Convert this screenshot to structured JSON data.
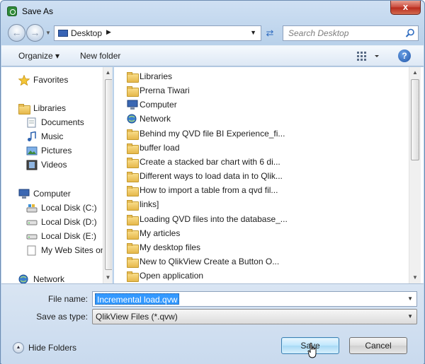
{
  "window": {
    "title": "Save As",
    "close_label": "x"
  },
  "address": {
    "location": "Desktop",
    "search_placeholder": "Search Desktop"
  },
  "toolbar": {
    "organize_label": "Organize ▾",
    "newfolder_label": "New folder"
  },
  "nav": {
    "favorites": "Favorites",
    "libraries": "Libraries",
    "library_items": [
      "Documents",
      "Music",
      "Pictures",
      "Videos"
    ],
    "computer": "Computer",
    "drives": [
      "Local Disk (C:)",
      "Local Disk (D:)",
      "Local Disk (E:)",
      "My Web Sites on"
    ],
    "network": "Network"
  },
  "files": [
    {
      "name": "Libraries",
      "icon": "library-icon"
    },
    {
      "name": "Prerna Tiwari",
      "icon": "user-folder-icon"
    },
    {
      "name": "Computer",
      "icon": "computer-icon"
    },
    {
      "name": "Network",
      "icon": "network-icon"
    },
    {
      "name": "Behind my QVD file   BI Experience_fi...",
      "icon": "folder-icon"
    },
    {
      "name": "buffer load",
      "icon": "folder-icon"
    },
    {
      "name": "Create a stacked bar chart with 6 di...",
      "icon": "folder-icon"
    },
    {
      "name": "Different ways to load data in to Qlik...",
      "icon": "folder-icon"
    },
    {
      "name": "How to import a table from a qvd fil...",
      "icon": "folder-icon"
    },
    {
      "name": "links]",
      "icon": "folder-icon"
    },
    {
      "name": "Loading QVD files into the database_...",
      "icon": "folder-icon"
    },
    {
      "name": "My articles",
      "icon": "folder-icon"
    },
    {
      "name": "My desktop files",
      "icon": "folder-icon"
    },
    {
      "name": "New to QlikView  Create a Button O...",
      "icon": "folder-icon"
    },
    {
      "name": "Open application",
      "icon": "folder-icon"
    }
  ],
  "form": {
    "filename_label": "File name:",
    "filename_value": "Incremental load.qvw",
    "savetype_label": "Save as type:",
    "savetype_value": "QlikView Files (*.qvw)"
  },
  "footer": {
    "hide_folders_label": "Hide Folders",
    "save_label": "Save",
    "cancel_label": "Cancel"
  }
}
